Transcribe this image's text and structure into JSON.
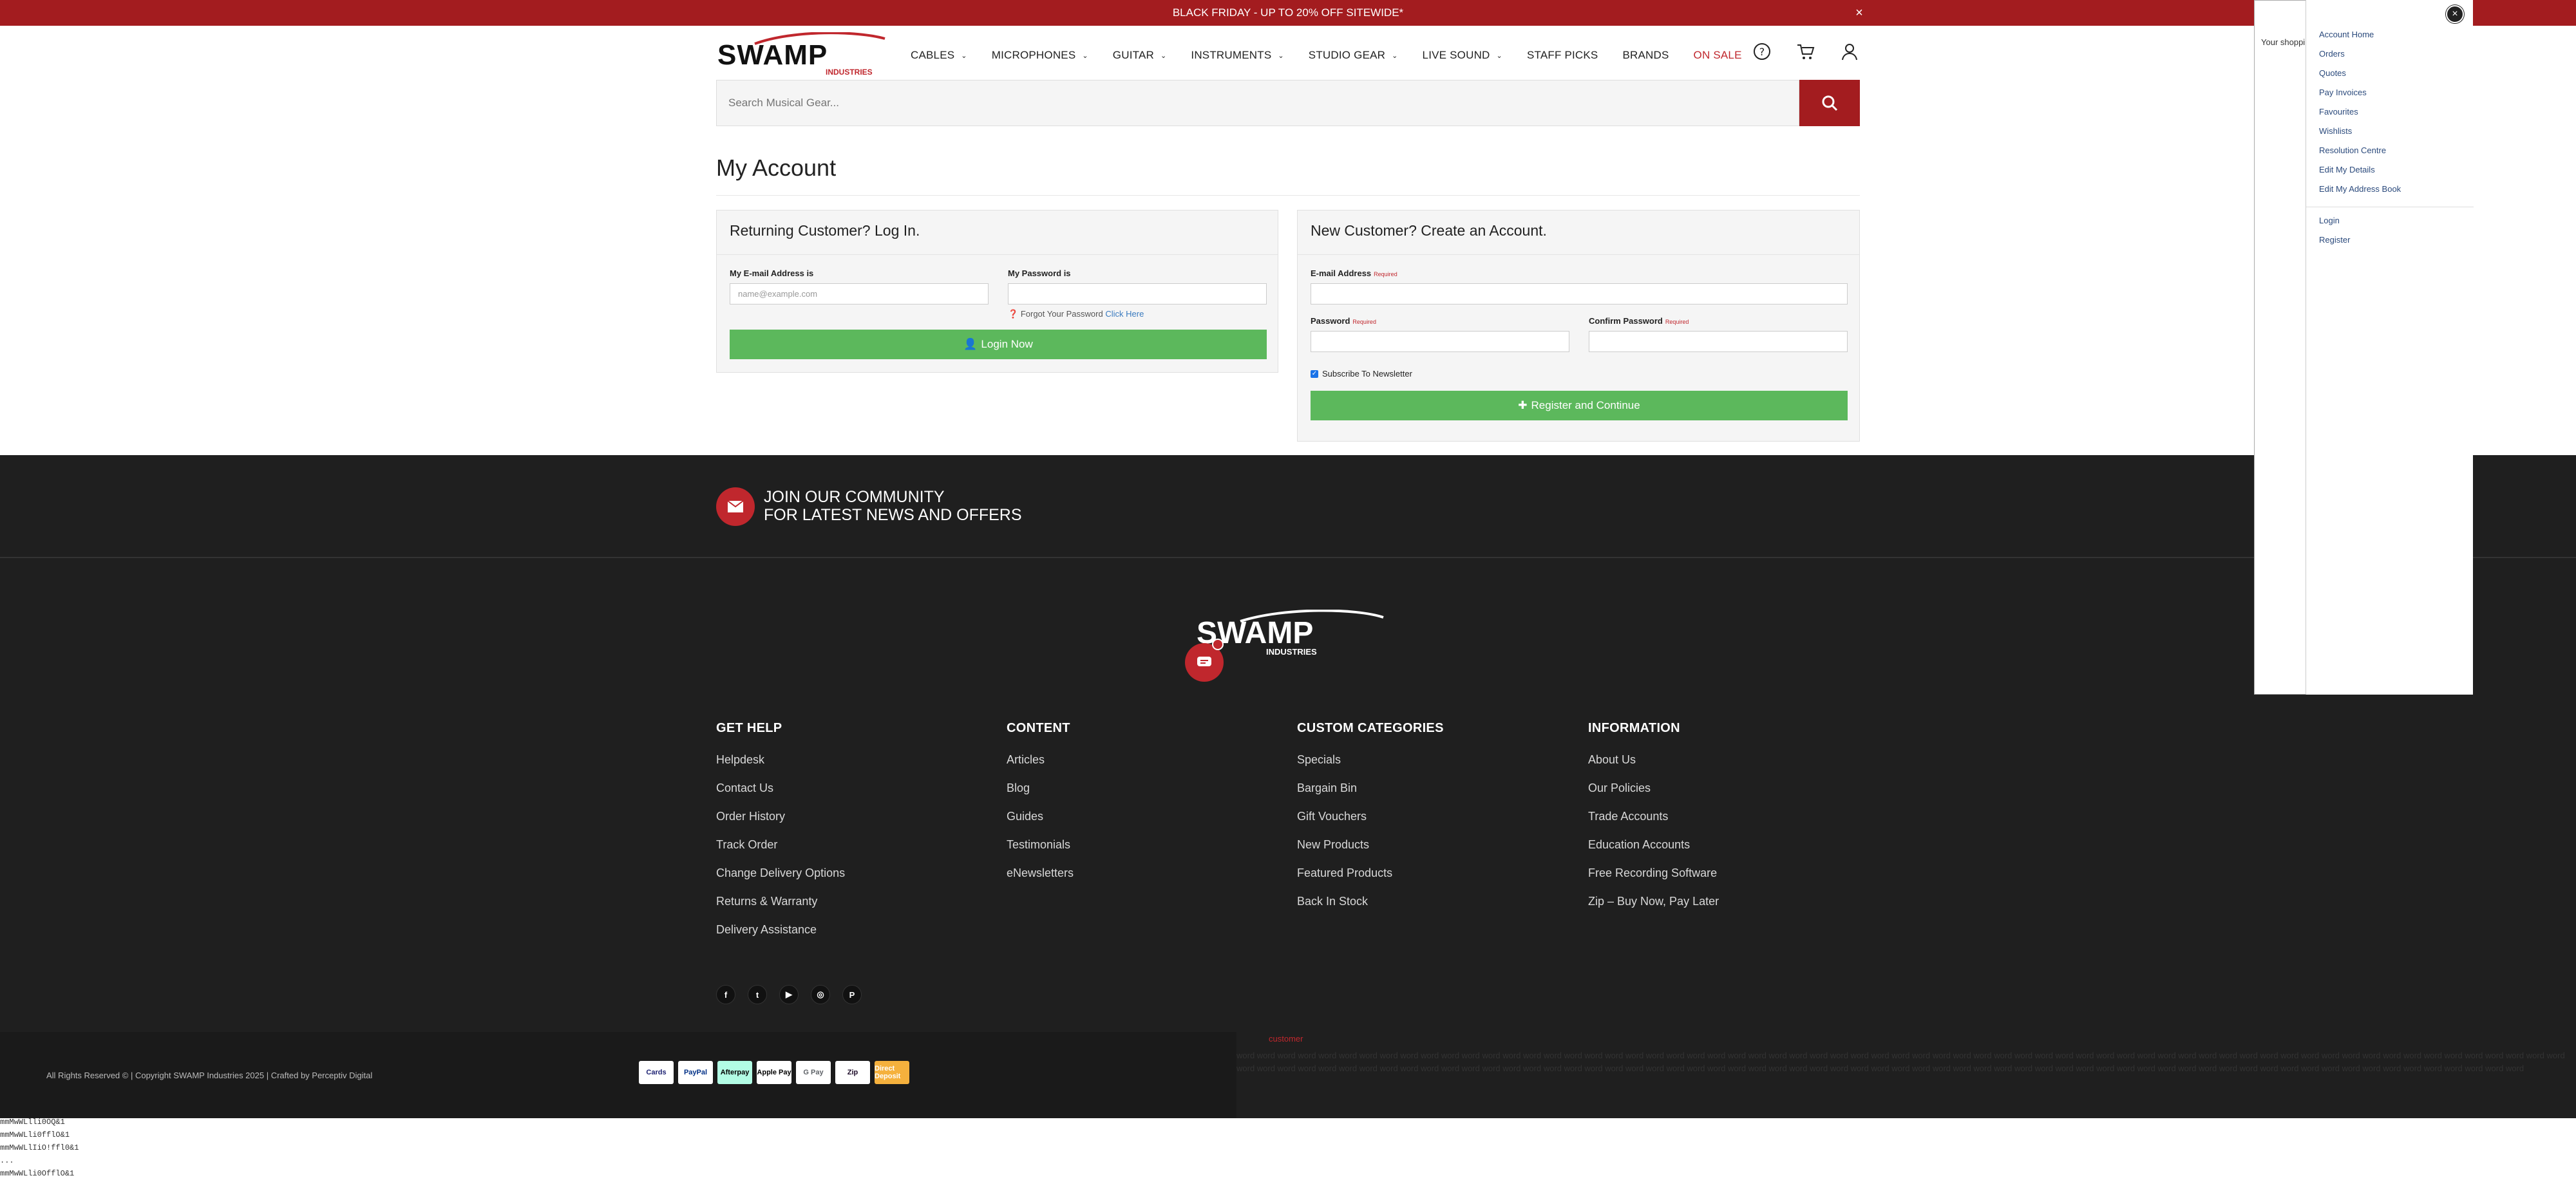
{
  "topbar": {
    "announcement": "BLACK FRIDAY - UP TO 20% OFF SITEWIDE*",
    "close": "×"
  },
  "brand": {
    "name": "SWAMP",
    "subname": "INDUSTRIES",
    "primary_color": "#a31c1f",
    "green": "#5cb85c"
  },
  "nav": [
    {
      "label": "CABLES",
      "has_menu": true
    },
    {
      "label": "MICROPHONES",
      "has_menu": true
    },
    {
      "label": "GUITAR",
      "has_menu": true
    },
    {
      "label": "INSTRUMENTS",
      "has_menu": true
    },
    {
      "label": "STUDIO GEAR",
      "has_menu": true
    },
    {
      "label": "LIVE SOUND",
      "has_menu": true
    },
    {
      "label": "STAFF PICKS",
      "has_menu": false
    },
    {
      "label": "BRANDS",
      "has_menu": false
    },
    {
      "label": "ON SALE",
      "has_menu": false
    }
  ],
  "header_icons": [
    "help-icon",
    "cart-icon",
    "user-icon"
  ],
  "search": {
    "placeholder": "Search Musical Gear..."
  },
  "page": {
    "title": "My Account"
  },
  "login": {
    "heading": "Returning Customer? Log In.",
    "email_label": "My E-mail Address is",
    "email_placeholder": "name@example.com",
    "password_label": "My Password is",
    "forgot_text": "Forgot Your Password",
    "forgot_link": "Click Here",
    "button": "Login Now"
  },
  "register": {
    "heading": "New Customer? Create an Account.",
    "email_label": "E-mail Address",
    "password_label": "Password",
    "confirm_label": "Confirm Password",
    "required": "Required",
    "newsletter": "Subscribe To Newsletter",
    "newsletter_checked": true,
    "button": "Register and Continue"
  },
  "community": {
    "line1": "JOIN OUR COMMUNITY",
    "line2": "FOR LATEST NEWS AND OFFERS"
  },
  "footer": {
    "columns": [
      {
        "heading": "GET HELP",
        "links": [
          "Helpdesk",
          "Contact Us",
          "Order History",
          "Track Order",
          "Change Delivery Options",
          "Returns & Warranty",
          "Delivery Assistance"
        ]
      },
      {
        "heading": "CONTENT",
        "links": [
          "Articles",
          "Blog",
          "Guides",
          "Testimonials",
          "eNewsletters"
        ]
      },
      {
        "heading": "CUSTOM CATEGORIES",
        "links": [
          "Specials",
          "Bargain Bin",
          "Gift Vouchers",
          "New Products",
          "Featured Products",
          "Back In Stock"
        ]
      },
      {
        "heading": "INFORMATION",
        "links": [
          "About Us",
          "Our Policies",
          "Trade Accounts",
          "Education Accounts",
          "Free Recording Software",
          "Zip – Buy Now, Pay Later"
        ]
      }
    ],
    "socials": [
      "facebook-icon",
      "twitter-icon",
      "youtube-icon",
      "instagram-icon",
      "pinterest-icon"
    ],
    "copyright": "All Rights Reserved © | Copyright SWAMP Industries 2025 | Crafted by Perceptiv Digital",
    "payments": [
      "Cards",
      "PayPal",
      "Afterpay",
      "Apple Pay",
      "G Pay",
      "Zip",
      "Direct Deposit"
    ]
  },
  "stray": {
    "red_text": "customer",
    "words": "word word word word word word word word word word word word word word word word word word word word word word word word word word word word word word word word word word word word word word word word word word word word word word word word word word word word word word word word word word word word word word word word word word word word word word word word word word word word word word word word word word word word word word word word word word word word word word word word word word word word word word word word word word word word word word word word word word word word word word word word word word word word word word word word",
    "mono": [
      "mmMwWLlli0OQ&1",
      "mmMwWLli0fflO&1",
      "mmMwWLlIiO!ffl0&1",
      "...",
      "mmMwWLli0OfflO&1"
    ]
  },
  "flyout": {
    "cart_text": "Your shopping cart a"
  },
  "account_menu": {
    "items": [
      "Account Home",
      "Orders",
      "Quotes",
      "Pay Invoices",
      "Favourites",
      "Wishlists",
      "Resolution Centre",
      "Edit My Details",
      "Edit My Address Book"
    ],
    "auth_items": [
      "Login",
      "Register"
    ],
    "close": "×"
  }
}
